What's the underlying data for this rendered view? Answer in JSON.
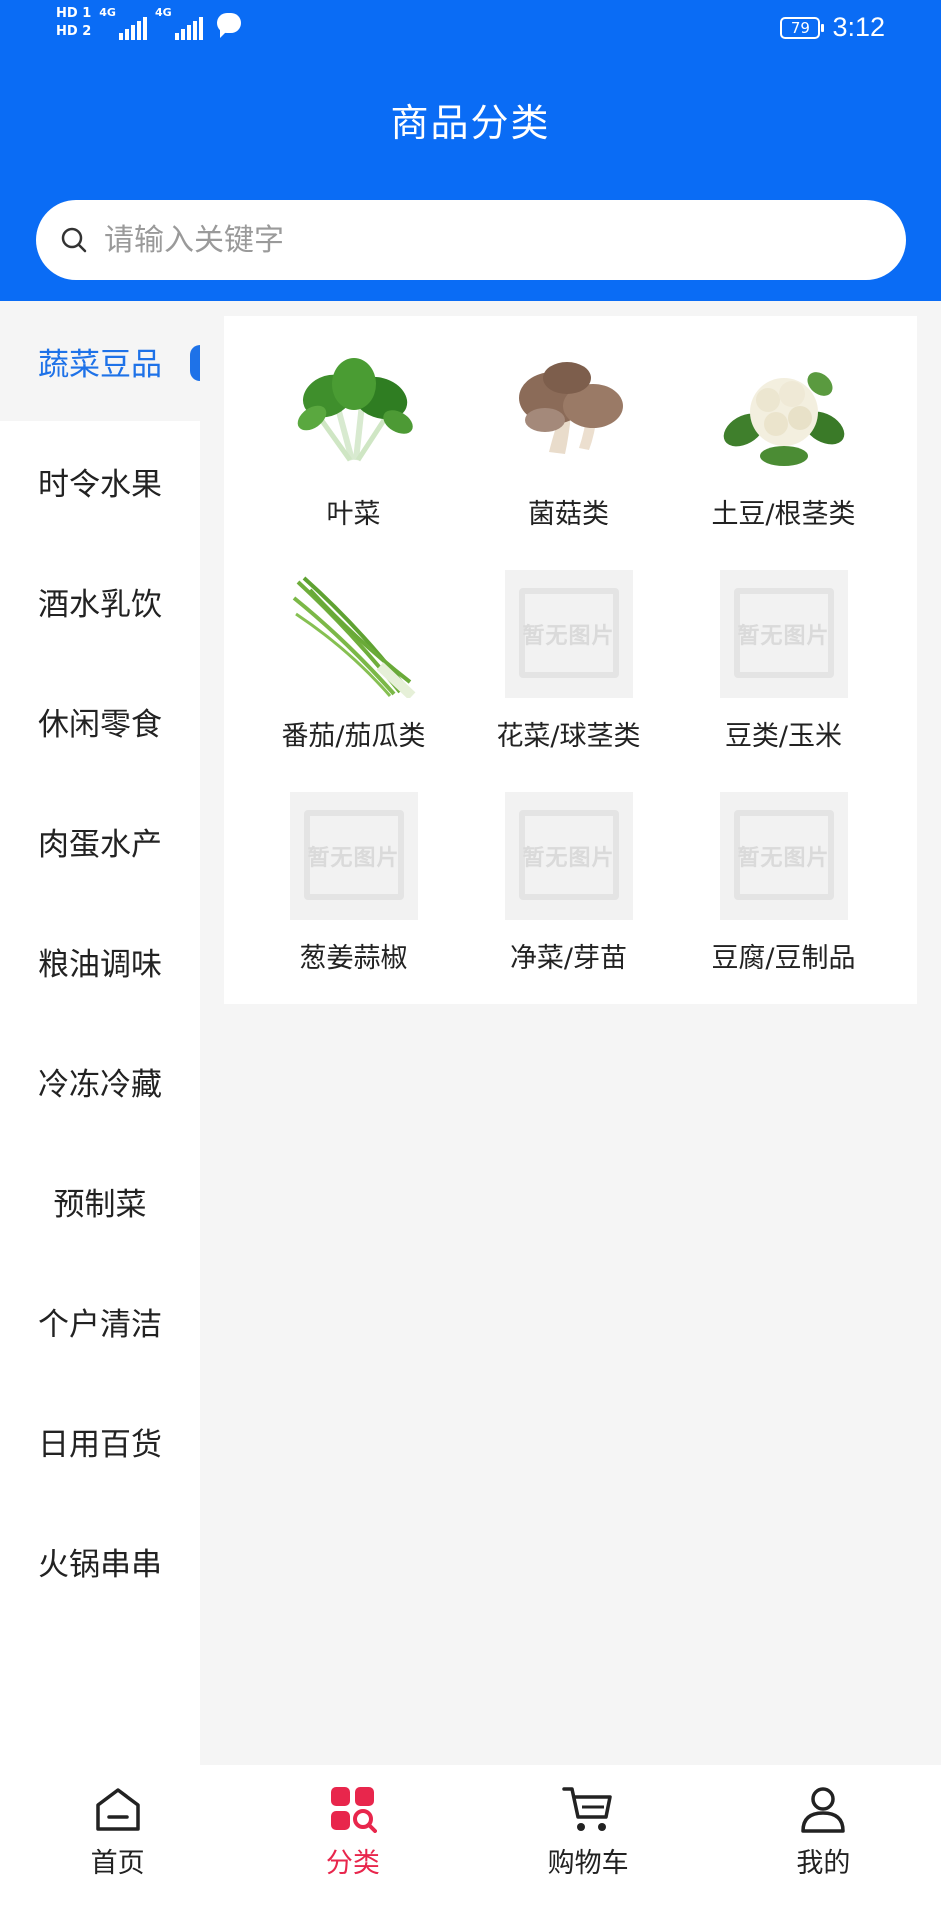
{
  "status_bar": {
    "sim_labels": [
      "HD 1",
      "HD 2"
    ],
    "network_labels": [
      "4G",
      "4G"
    ],
    "battery": "79",
    "time": "3:12"
  },
  "header": {
    "title": "商品分类",
    "bg_color": "#0a6cf5"
  },
  "search": {
    "placeholder": "请输入关键字",
    "icon": "search-icon"
  },
  "sidebar": {
    "active_color": "#1e72e8",
    "items": [
      {
        "label": "蔬菜豆品",
        "active": true
      },
      {
        "label": "时令水果"
      },
      {
        "label": "酒水乳饮"
      },
      {
        "label": "休闲零食"
      },
      {
        "label": "肉蛋水产"
      },
      {
        "label": "粮油调味"
      },
      {
        "label": "冷冻冷藏"
      },
      {
        "label": "预制菜"
      },
      {
        "label": "个户清洁"
      },
      {
        "label": "日用百货"
      },
      {
        "label": "火锅串串"
      }
    ]
  },
  "categories": {
    "placeholder_text": "暂无图片",
    "items": [
      {
        "label": "叶菜",
        "image": "leafy-greens"
      },
      {
        "label": "菌菇类",
        "image": "mushrooms"
      },
      {
        "label": "土豆/根茎类",
        "image": "cauliflower"
      },
      {
        "label": "番茄/茄瓜类",
        "image": "chives"
      },
      {
        "label": "花菜/球茎类",
        "image": "placeholder"
      },
      {
        "label": "豆类/玉米",
        "image": "placeholder"
      },
      {
        "label": "葱姜蒜椒",
        "image": "placeholder"
      },
      {
        "label": "净菜/芽苗",
        "image": "placeholder"
      },
      {
        "label": "豆腐/豆制品",
        "image": "placeholder"
      }
    ]
  },
  "tabbar": {
    "active_color": "#e8264c",
    "items": [
      {
        "label": "首页",
        "icon": "home-icon"
      },
      {
        "label": "分类",
        "icon": "category-icon",
        "active": true
      },
      {
        "label": "购物车",
        "icon": "cart-icon"
      },
      {
        "label": "我的",
        "icon": "profile-icon"
      }
    ]
  }
}
